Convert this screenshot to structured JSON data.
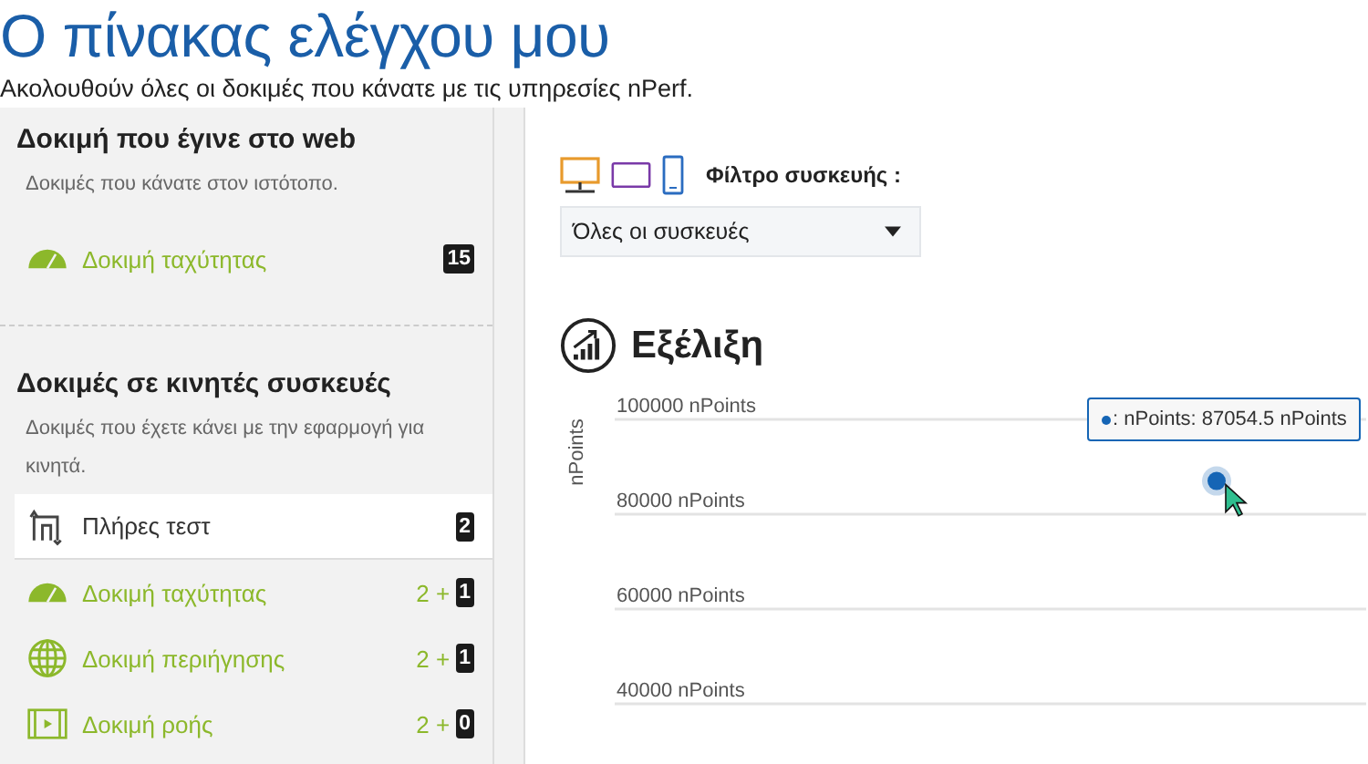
{
  "page": {
    "title": "Ο πίνακας ελέγχου μου",
    "subtitle": "Ακολουθούν όλες οι δοκιμές που κάνατε με τις υπηρεσίες nPerf."
  },
  "sidebar": {
    "sections": [
      {
        "title": "Δοκιμή που έγινε στο web",
        "description": "Δοκιμές που κάνατε στον ιστότοπο.",
        "items": [
          {
            "kind": "speed",
            "label": "Δοκιμή ταχύτητας",
            "selected": false,
            "count": "15"
          }
        ]
      },
      {
        "title": "Δοκιμές σε κινητές συσκευές",
        "description": "Δοκιμές που έχετε κάνει με την εφαρμογή για κινητά.",
        "items": [
          {
            "kind": "full",
            "label": "Πλήρες τεστ",
            "selected": true,
            "count": "2"
          },
          {
            "kind": "speed",
            "label": "Δοκιμή ταχύτητας",
            "selected": false,
            "prefix": "2 +",
            "count": "1"
          },
          {
            "kind": "browse",
            "label": "Δοκιμή περιήγησης",
            "selected": false,
            "prefix": "2 +",
            "count": "1"
          },
          {
            "kind": "stream",
            "label": "Δοκιμή ροής",
            "selected": false,
            "prefix": "2 +",
            "count": "0"
          }
        ]
      }
    ]
  },
  "filter": {
    "label": "Φίλτρο συσκευής :",
    "value": "Όλες οι συσκευές"
  },
  "evolution": {
    "title": "Εξέλιξη",
    "tooltip": ": nPoints: 87054.5 nPoints",
    "chart_data": {
      "type": "scatter",
      "ylabel": "nPoints",
      "grid": true,
      "ylim": [
        40000,
        100000
      ],
      "yticks": [
        {
          "value": 40000,
          "label": "40000 nPoints"
        },
        {
          "value": 60000,
          "label": "60000 nPoints"
        },
        {
          "value": 80000,
          "label": "80000 nPoints"
        },
        {
          "value": 100000,
          "label": "100000 nPoints"
        }
      ],
      "series": [
        {
          "color": "#1565b5",
          "values": [
            87000
          ]
        }
      ]
    }
  }
}
